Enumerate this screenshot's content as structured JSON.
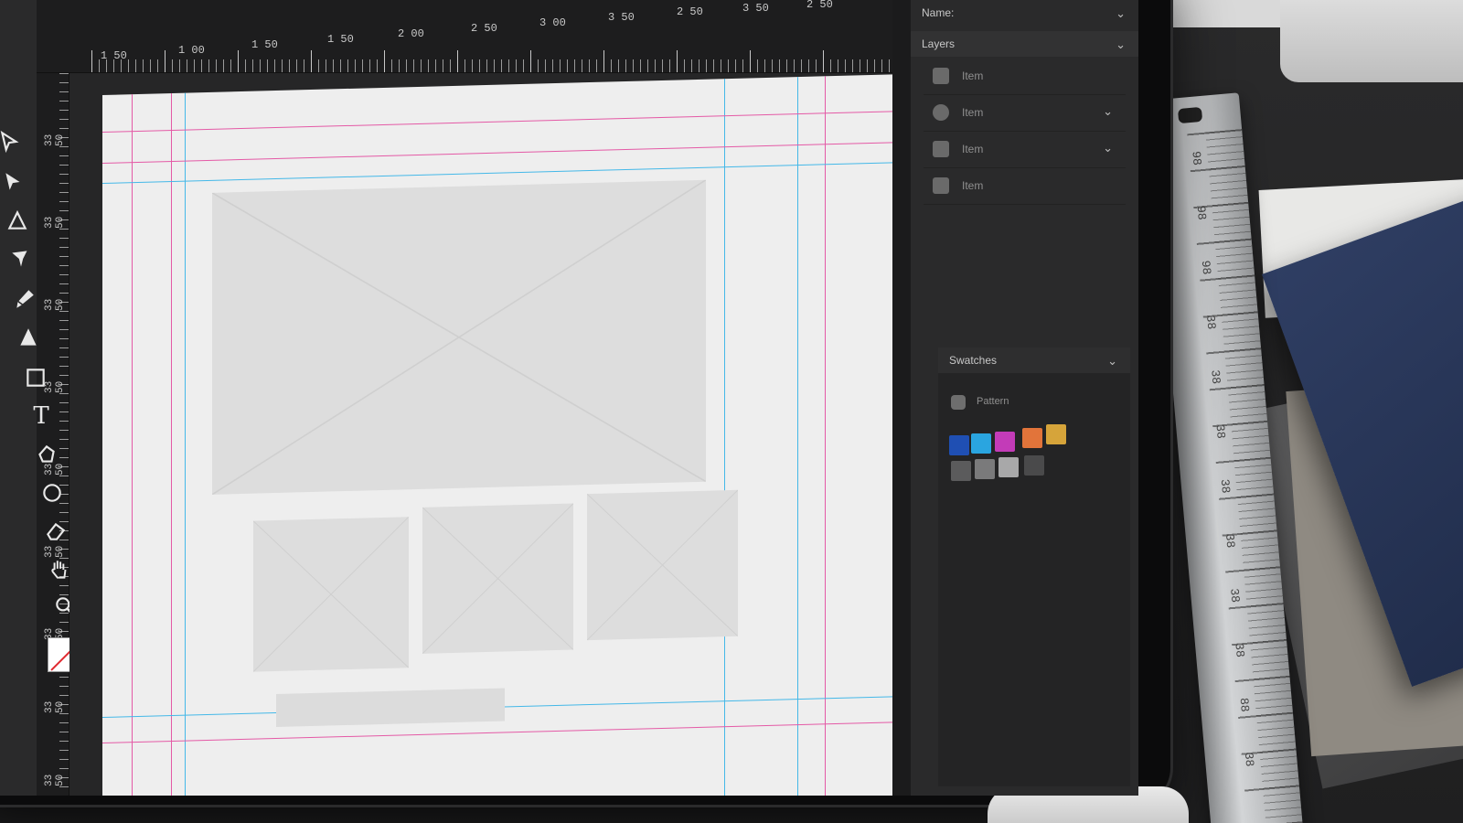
{
  "app": {
    "panel_header_top": "Name:",
    "panel_header_top_value": "",
    "layers_panel_title": "Layers",
    "swatches_panel_title": "Swatches"
  },
  "ruler_top": {
    "labels": [
      "1 50",
      "1 00",
      "1 50",
      "1 50",
      "2 00",
      "2 50",
      "3 00",
      "3 50",
      "2 50",
      "3 50",
      "2 50"
    ]
  },
  "ruler_left": {
    "labels": [
      "33 50",
      "33 50",
      "33 50",
      "33 50",
      "33 50",
      "33 50",
      "33 50",
      "33 50",
      "33 50",
      "33 50"
    ]
  },
  "tools": [
    {
      "name": "selection-tool",
      "icon": "arrow-outline-icon"
    },
    {
      "name": "direct-selection-tool",
      "icon": "arrow-filled-icon"
    },
    {
      "name": "direct-selection-alt-tool",
      "icon": "arrow-outline-icon"
    },
    {
      "name": "paint-bucket-tool",
      "icon": "bucket-icon"
    },
    {
      "name": "brush-tool",
      "icon": "brush-icon"
    },
    {
      "name": "pen-tool",
      "icon": "pen-icon"
    },
    {
      "name": "rectangle-tool",
      "icon": "rectangle-icon"
    },
    {
      "name": "type-tool",
      "icon": "type-icon"
    },
    {
      "name": "shape-builder-tool",
      "icon": "shape-icon"
    },
    {
      "name": "ellipse-tool",
      "icon": "ellipse-icon"
    },
    {
      "name": "eraser-tool",
      "icon": "eraser-icon"
    },
    {
      "name": "hand-tool",
      "icon": "hand-icon"
    },
    {
      "name": "zoom-tool",
      "icon": "zoom-icon"
    }
  ],
  "tool_glyphs": {
    "type": "T"
  },
  "layers": [
    {
      "label": "Item"
    },
    {
      "label": "Item"
    },
    {
      "label": "Item"
    },
    {
      "label": "Item"
    }
  ],
  "swatches_row_label": "Pattern",
  "swatch_colors": {
    "row1": [
      "#1f4fb3",
      "#2aa5e0",
      "#c33bb8",
      "#e2743a",
      "#d6a43a"
    ],
    "row2": [
      "#5b5b5c",
      "#7a7a7b",
      "#a8a8a9",
      "#4a4a4b"
    ]
  },
  "guide_colors": {
    "cyan": "#44b8e8",
    "magenta": "#e45aa6"
  },
  "ruler_physical": {
    "labels": [
      "98",
      "98",
      "98",
      "38",
      "38",
      "38",
      "38",
      "38",
      "38",
      "38",
      "88",
      "38"
    ]
  }
}
